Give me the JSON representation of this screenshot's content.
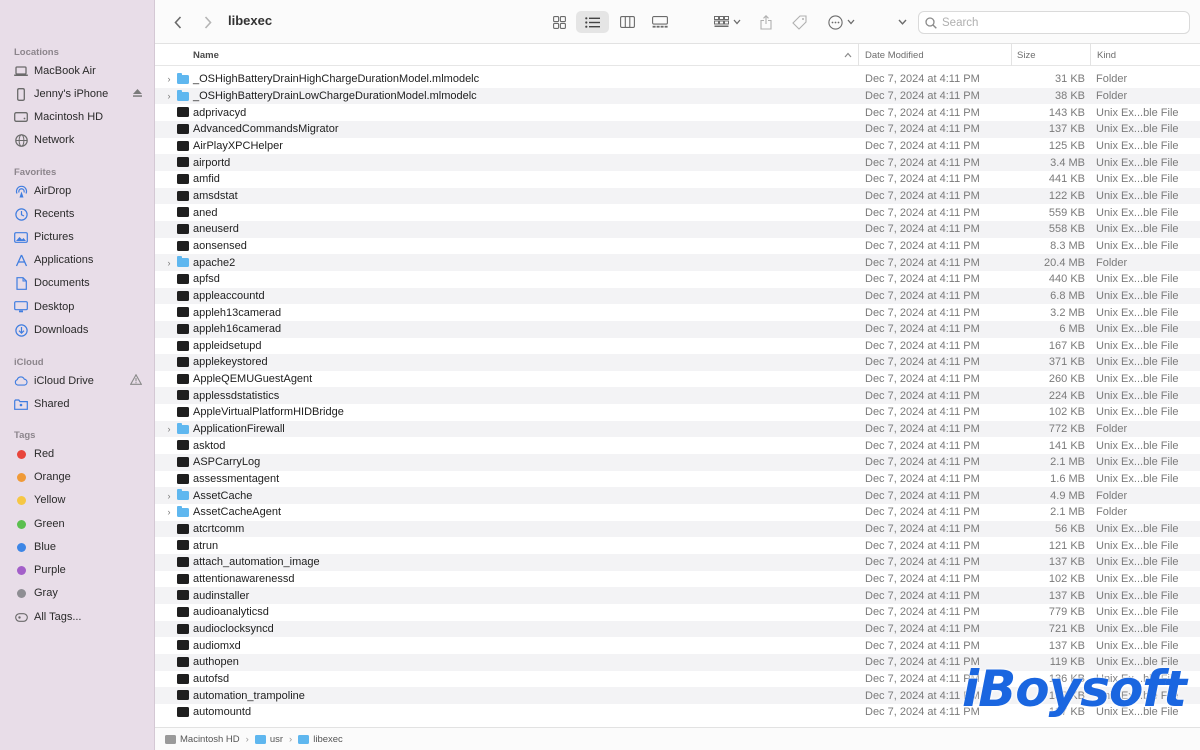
{
  "window": {
    "title": "libexec"
  },
  "search": {
    "placeholder": "Search",
    "value": ""
  },
  "sidebar": {
    "locations_header": "Locations",
    "locations": [
      {
        "label": "MacBook Air",
        "icon": "laptop-icon"
      },
      {
        "label": "Jenny's iPhone",
        "icon": "iphone-icon",
        "trail": "eject-icon"
      },
      {
        "label": "Macintosh HD",
        "icon": "hard-drive-icon"
      },
      {
        "label": "Network",
        "icon": "globe-icon"
      }
    ],
    "favorites_header": "Favorites",
    "favorites": [
      {
        "label": "AirDrop",
        "icon": "airdrop-icon"
      },
      {
        "label": "Recents",
        "icon": "clock-icon"
      },
      {
        "label": "Pictures",
        "icon": "pictures-icon"
      },
      {
        "label": "Applications",
        "icon": "applications-icon"
      },
      {
        "label": "Documents",
        "icon": "document-icon"
      },
      {
        "label": "Desktop",
        "icon": "desktop-icon"
      },
      {
        "label": "Downloads",
        "icon": "download-icon"
      }
    ],
    "icloud_header": "iCloud",
    "icloud": [
      {
        "label": "iCloud Drive",
        "icon": "cloud-icon",
        "trail": "warning-icon"
      },
      {
        "label": "Shared",
        "icon": "shared-folder-icon"
      }
    ],
    "tags_header": "Tags",
    "tags": [
      {
        "label": "Red",
        "color": "#e8453c"
      },
      {
        "label": "Orange",
        "color": "#f09a37"
      },
      {
        "label": "Yellow",
        "color": "#f6c744"
      },
      {
        "label": "Green",
        "color": "#5bbf4f"
      },
      {
        "label": "Blue",
        "color": "#3d86e6"
      },
      {
        "label": "Purple",
        "color": "#a35fc9"
      },
      {
        "label": "Gray",
        "color": "#8e8e93"
      },
      {
        "label": "All Tags...",
        "color": ""
      }
    ]
  },
  "columns": {
    "name": "Name",
    "date": "Date Modified",
    "size": "Size",
    "kind": "Kind"
  },
  "files": [
    {
      "name": "_OSHighBatteryDrainHighChargeDurationModel.mlmodelc",
      "date": "Dec 7, 2024 at 4:11 PM",
      "size": "31 KB",
      "kind": "Folder",
      "type": "folder"
    },
    {
      "name": "_OSHighBatteryDrainLowChargeDurationModel.mlmodelc",
      "date": "Dec 7, 2024 at 4:11 PM",
      "size": "38 KB",
      "kind": "Folder",
      "type": "folder"
    },
    {
      "name": "adprivacyd",
      "date": "Dec 7, 2024 at 4:11 PM",
      "size": "143 KB",
      "kind": "Unix Ex...ble File",
      "type": "exe"
    },
    {
      "name": "AdvancedCommandsMigrator",
      "date": "Dec 7, 2024 at 4:11 PM",
      "size": "137 KB",
      "kind": "Unix Ex...ble File",
      "type": "exe"
    },
    {
      "name": "AirPlayXPCHelper",
      "date": "Dec 7, 2024 at 4:11 PM",
      "size": "125 KB",
      "kind": "Unix Ex...ble File",
      "type": "exe"
    },
    {
      "name": "airportd",
      "date": "Dec 7, 2024 at 4:11 PM",
      "size": "3.4 MB",
      "kind": "Unix Ex...ble File",
      "type": "exe"
    },
    {
      "name": "amfid",
      "date": "Dec 7, 2024 at 4:11 PM",
      "size": "441 KB",
      "kind": "Unix Ex...ble File",
      "type": "exe"
    },
    {
      "name": "amsdstat",
      "date": "Dec 7, 2024 at 4:11 PM",
      "size": "122 KB",
      "kind": "Unix Ex...ble File",
      "type": "exe"
    },
    {
      "name": "aned",
      "date": "Dec 7, 2024 at 4:11 PM",
      "size": "559 KB",
      "kind": "Unix Ex...ble File",
      "type": "exe"
    },
    {
      "name": "aneuserd",
      "date": "Dec 7, 2024 at 4:11 PM",
      "size": "558 KB",
      "kind": "Unix Ex...ble File",
      "type": "exe"
    },
    {
      "name": "aonsensed",
      "date": "Dec 7, 2024 at 4:11 PM",
      "size": "8.3 MB",
      "kind": "Unix Ex...ble File",
      "type": "exe"
    },
    {
      "name": "apache2",
      "date": "Dec 7, 2024 at 4:11 PM",
      "size": "20.4 MB",
      "kind": "Folder",
      "type": "folder"
    },
    {
      "name": "apfsd",
      "date": "Dec 7, 2024 at 4:11 PM",
      "size": "440 KB",
      "kind": "Unix Ex...ble File",
      "type": "exe"
    },
    {
      "name": "appleaccountd",
      "date": "Dec 7, 2024 at 4:11 PM",
      "size": "6.8 MB",
      "kind": "Unix Ex...ble File",
      "type": "exe"
    },
    {
      "name": "appleh13camerad",
      "date": "Dec 7, 2024 at 4:11 PM",
      "size": "3.2 MB",
      "kind": "Unix Ex...ble File",
      "type": "exe"
    },
    {
      "name": "appleh16camerad",
      "date": "Dec 7, 2024 at 4:11 PM",
      "size": "6 MB",
      "kind": "Unix Ex...ble File",
      "type": "exe"
    },
    {
      "name": "appleidsetupd",
      "date": "Dec 7, 2024 at 4:11 PM",
      "size": "167 KB",
      "kind": "Unix Ex...ble File",
      "type": "exe"
    },
    {
      "name": "applekeystored",
      "date": "Dec 7, 2024 at 4:11 PM",
      "size": "371 KB",
      "kind": "Unix Ex...ble File",
      "type": "exe"
    },
    {
      "name": "AppleQEMUGuestAgent",
      "date": "Dec 7, 2024 at 4:11 PM",
      "size": "260 KB",
      "kind": "Unix Ex...ble File",
      "type": "exe"
    },
    {
      "name": "applessdstatistics",
      "date": "Dec 7, 2024 at 4:11 PM",
      "size": "224 KB",
      "kind": "Unix Ex...ble File",
      "type": "exe"
    },
    {
      "name": "AppleVirtualPlatformHIDBridge",
      "date": "Dec 7, 2024 at 4:11 PM",
      "size": "102 KB",
      "kind": "Unix Ex...ble File",
      "type": "exe"
    },
    {
      "name": "ApplicationFirewall",
      "date": "Dec 7, 2024 at 4:11 PM",
      "size": "772 KB",
      "kind": "Folder",
      "type": "folder"
    },
    {
      "name": "asktod",
      "date": "Dec 7, 2024 at 4:11 PM",
      "size": "141 KB",
      "kind": "Unix Ex...ble File",
      "type": "exe"
    },
    {
      "name": "ASPCarryLog",
      "date": "Dec 7, 2024 at 4:11 PM",
      "size": "2.1 MB",
      "kind": "Unix Ex...ble File",
      "type": "exe"
    },
    {
      "name": "assessmentagent",
      "date": "Dec 7, 2024 at 4:11 PM",
      "size": "1.6 MB",
      "kind": "Unix Ex...ble File",
      "type": "exe"
    },
    {
      "name": "AssetCache",
      "date": "Dec 7, 2024 at 4:11 PM",
      "size": "4.9 MB",
      "kind": "Folder",
      "type": "folder"
    },
    {
      "name": "AssetCacheAgent",
      "date": "Dec 7, 2024 at 4:11 PM",
      "size": "2.1 MB",
      "kind": "Folder",
      "type": "folder"
    },
    {
      "name": "atcrtcomm",
      "date": "Dec 7, 2024 at 4:11 PM",
      "size": "56 KB",
      "kind": "Unix Ex...ble File",
      "type": "exe"
    },
    {
      "name": "atrun",
      "date": "Dec 7, 2024 at 4:11 PM",
      "size": "121 KB",
      "kind": "Unix Ex...ble File",
      "type": "exe"
    },
    {
      "name": "attach_automation_image",
      "date": "Dec 7, 2024 at 4:11 PM",
      "size": "137 KB",
      "kind": "Unix Ex...ble File",
      "type": "exe"
    },
    {
      "name": "attentionawarenessd",
      "date": "Dec 7, 2024 at 4:11 PM",
      "size": "102 KB",
      "kind": "Unix Ex...ble File",
      "type": "exe"
    },
    {
      "name": "audinstaller",
      "date": "Dec 7, 2024 at 4:11 PM",
      "size": "137 KB",
      "kind": "Unix Ex...ble File",
      "type": "exe"
    },
    {
      "name": "audioanalyticsd",
      "date": "Dec 7, 2024 at 4:11 PM",
      "size": "779 KB",
      "kind": "Unix Ex...ble File",
      "type": "exe"
    },
    {
      "name": "audioclocksyncd",
      "date": "Dec 7, 2024 at 4:11 PM",
      "size": "721 KB",
      "kind": "Unix Ex...ble File",
      "type": "exe"
    },
    {
      "name": "audiomxd",
      "date": "Dec 7, 2024 at 4:11 PM",
      "size": "137 KB",
      "kind": "Unix Ex...ble File",
      "type": "exe"
    },
    {
      "name": "authopen",
      "date": "Dec 7, 2024 at 4:11 PM",
      "size": "119 KB",
      "kind": "Unix Ex...ble File",
      "type": "exe"
    },
    {
      "name": "autofsd",
      "date": "Dec 7, 2024 at 4:11 PM",
      "size": "136 KB",
      "kind": "Unix Ex...ble File",
      "type": "exe"
    },
    {
      "name": "automation_trampoline",
      "date": "Dec 7, 2024 at 4:11 PM",
      "size": "137 KB",
      "kind": "Unix Ex...ble File",
      "type": "exe"
    },
    {
      "name": "automountd",
      "date": "Dec 7, 2024 at 4:11 PM",
      "size": "137 KB",
      "kind": "Unix Ex...ble File",
      "type": "exe"
    }
  ],
  "pathbar": {
    "items": [
      "Macintosh HD",
      "usr",
      "libexec"
    ]
  },
  "watermark": "iBoysoft"
}
